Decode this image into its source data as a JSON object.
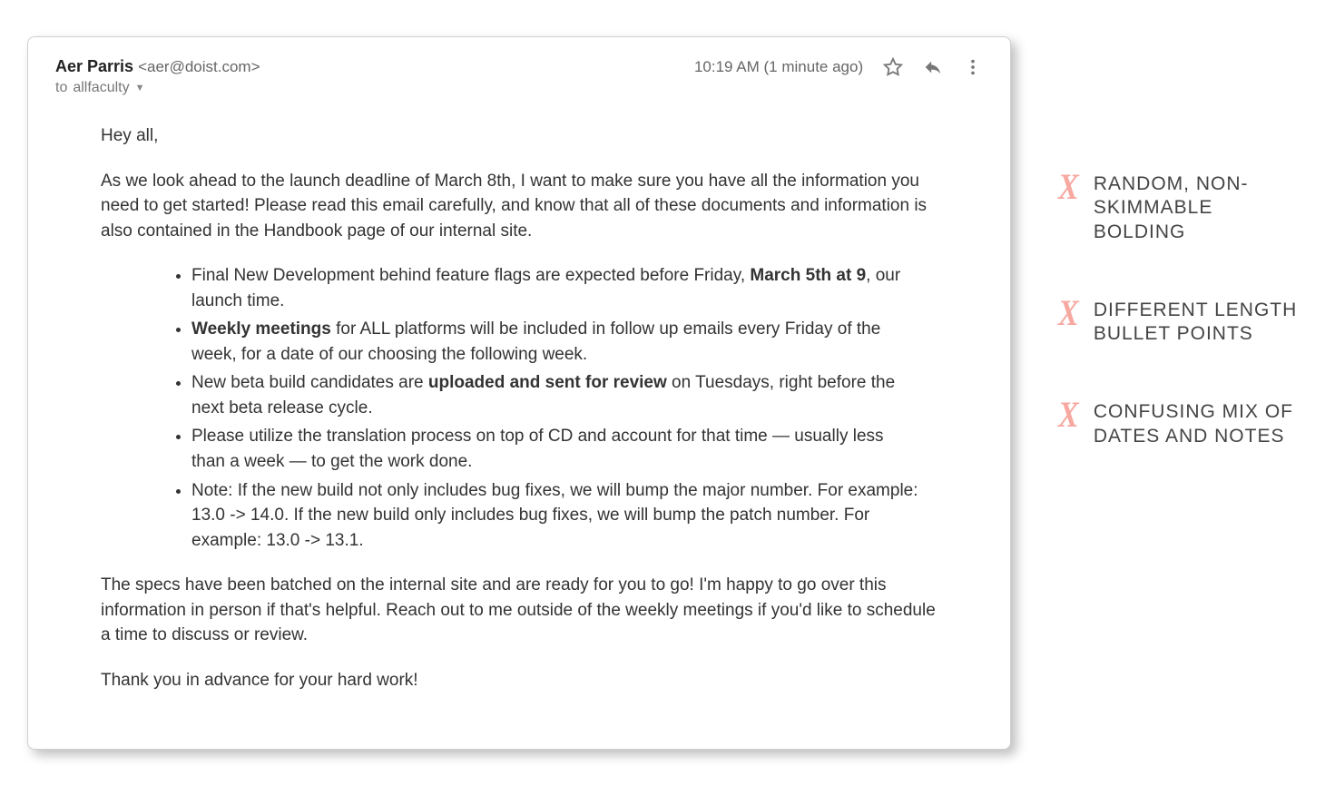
{
  "email": {
    "from_name": "Aer Parris",
    "from_email": "<aer@doist.com>",
    "to_prefix": "to ",
    "to_recipient": "allfaculty",
    "timestamp": "10:19 AM (1 minute ago)",
    "greeting": "Hey all,",
    "intro": "As we look ahead to the launch deadline of March 8th, I want to make sure you have all the information you need to get started! Please read this email carefully, and know that all of these documents and information is also contained in the Handbook page of our internal site.",
    "bullets": {
      "b1_pre": "Final New Development behind feature flags are expected before Friday, ",
      "b1_bold": "March 5th at 9",
      "b1_post": ", our launch time.",
      "b2_bold": "Weekly meetings",
      "b2_post": " for ALL platforms will be included in follow up emails every Friday of the week, for a date of our choosing the following week.",
      "b3_pre": "New beta build candidates are ",
      "b3_bold": "uploaded and sent for review",
      "b3_post": " on Tuesdays, right before the next beta release cycle.",
      "b4": "Please utilize the translation process on top of CD and account for that time — usually less than a week — to get the work done.",
      "b5": "Note: If the new build not only includes bug fixes, we will bump the major number. For example: 13.0 -> 14.0. If the new build only includes bug fixes, we will bump the patch number. For example: 13.0 -> 13.1."
    },
    "outro": "The specs have been batched on the internal site and are ready for you to go! I'm happy to go over this information in person if that's helpful. Reach out to me outside of the weekly meetings if you'd like to schedule a time to discuss or review.",
    "signoff": "Thank you in advance for your hard work!"
  },
  "annotations": {
    "x": "X",
    "a1": "Random, non-skimmable bolding",
    "a2": "Different length bullet points",
    "a3": "Confusing mix of dates and notes"
  }
}
